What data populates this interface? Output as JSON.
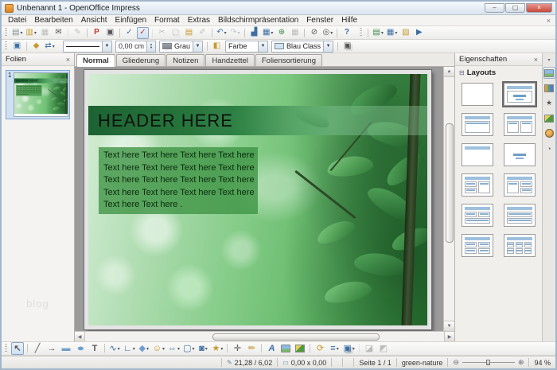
{
  "window": {
    "title": "Unbenannt 1 - OpenOffice Impress",
    "minimize": "–",
    "maximize": "▢",
    "close": "×",
    "doc_close": "×"
  },
  "menu": [
    "Datei",
    "Bearbeiten",
    "Ansicht",
    "Einfügen",
    "Format",
    "Extras",
    "Bildschirmpräsentation",
    "Fenster",
    "Hilfe"
  ],
  "toolbar_standard": [
    {
      "name": "new-icon",
      "g": "▤",
      "cls": "c-doc",
      "d": 1
    },
    {
      "name": "open-icon",
      "g": "▥",
      "cls": "c-gold",
      "d": 1
    },
    {
      "name": "save-icon",
      "g": "▦",
      "cls": "grayed"
    },
    {
      "name": "email-icon",
      "g": "✉"
    },
    {
      "name": "edit-file-icon",
      "g": "✎",
      "cls": "sep grayed"
    },
    {
      "name": "export-pdf-icon",
      "g": "P",
      "cls": "sep c-red bold"
    },
    {
      "name": "print-icon",
      "g": "▣"
    },
    {
      "name": "spellcheck-icon",
      "g": "✓",
      "cls": "sep c-blue"
    },
    {
      "name": "autospellcheck-icon",
      "g": "✓",
      "cls": "boxed c-red"
    },
    {
      "name": "cut-icon",
      "g": "✂",
      "cls": "sep grayed"
    },
    {
      "name": "copy-icon",
      "g": "▢",
      "cls": "grayed dbl"
    },
    {
      "name": "paste-icon",
      "g": "▤",
      "cls": "c-gold"
    },
    {
      "name": "format-paintbrush-icon",
      "g": "✐",
      "cls": "grayed"
    },
    {
      "name": "undo-icon",
      "g": "↶",
      "cls": "sep c-blue",
      "d": 1
    },
    {
      "name": "redo-icon",
      "g": "↷",
      "cls": "c-blue grayed",
      "d": 1
    },
    {
      "name": "chart-icon",
      "g": "▟",
      "cls": "sep c-blue"
    },
    {
      "name": "table-icon",
      "g": "▦",
      "cls": "c-blue",
      "d": 1
    },
    {
      "name": "hyperlink-icon",
      "g": "⊕",
      "cls": "c-green"
    },
    {
      "name": "grid-icon",
      "g": "▦",
      "cls": "grayed"
    },
    {
      "name": "zoom-icon",
      "g": "⊘",
      "cls": "sep"
    },
    {
      "name": "find-icon",
      "g": "◎",
      "d": 1
    },
    {
      "name": "help-icon",
      "g": "?",
      "cls": "sep c-blue bold"
    }
  ],
  "toolbar_presentation": [
    {
      "name": "slide-icon",
      "g": "▤",
      "cls": "sep c-green",
      "d": 1
    },
    {
      "name": "slide-layout-icon",
      "g": "▦",
      "cls": "c-blue",
      "d": 1
    },
    {
      "name": "slide-design-icon",
      "g": "▨",
      "cls": "c-gold"
    },
    {
      "name": "slideshow-icon",
      "g": "▶",
      "cls": "c-blue"
    }
  ],
  "line_fill": {
    "display_icon": {
      "name": "display-icon",
      "g": "▣"
    },
    "line_props_icon": {
      "name": "line-icon",
      "g": "◆"
    },
    "arrow_style_icon": {
      "name": "arrow-style-icon",
      "g": "⇄"
    },
    "line_width": "0,00 cm",
    "line_color": "Grau",
    "area_icon": {
      "name": "area-style-icon",
      "g": "◧"
    },
    "fill_type": "Farbe",
    "fill_color": "Blau Class",
    "shadow_icon": {
      "name": "shadow-icon",
      "g": "▣"
    }
  },
  "tabs": [
    {
      "label": "Normal",
      "active": true
    },
    {
      "label": "Gliederung"
    },
    {
      "label": "Notizen"
    },
    {
      "label": "Handzettel"
    },
    {
      "label": "Foliensortierung"
    }
  ],
  "slides_panel": {
    "title": "Folien",
    "close": "×",
    "slide_number": "1",
    "watermark": "blog"
  },
  "slide": {
    "header": "HEADER HERE",
    "body_lines": [
      "Text here Text here Text here Text here",
      "Text here Text here Text here Text here",
      "Text here Text here Text here Text here",
      "Text here Text here Text here Text here",
      "Text here Text here ."
    ]
  },
  "sidebar": {
    "title": "Eigenschaften",
    "close": "×",
    "collapse_icon": "⊟",
    "section": "Layouts",
    "layouts": [
      {
        "name": "layout-blank",
        "type": "blank"
      },
      {
        "name": "layout-title-slide",
        "type": "title-slide",
        "selected": true
      },
      {
        "name": "layout-title-content",
        "type": "title-content"
      },
      {
        "name": "layout-title-2content",
        "type": "title-2content"
      },
      {
        "name": "layout-title-only",
        "type": "title-only"
      },
      {
        "name": "layout-centered-text",
        "type": "centered-text"
      },
      {
        "name": "layout-title-2content-content",
        "type": "t2cc"
      },
      {
        "name": "layout-title-content-2content",
        "type": "tc2c"
      },
      {
        "name": "layout-title-2content-over-content",
        "type": "t2coc"
      },
      {
        "name": "layout-title-content-over-content",
        "type": "tcoc"
      },
      {
        "name": "layout-title-4content",
        "type": "t4c"
      },
      {
        "name": "layout-title-6content",
        "type": "t6c"
      }
    ],
    "tabs": [
      {
        "name": "sidebar-settings-icon",
        "g": "▾",
        "cls": "small"
      },
      {
        "name": "properties-tab-icon",
        "cls": "active"
      },
      {
        "name": "master-pages-tab-icon",
        "cls": ""
      },
      {
        "name": "animation-tab-icon",
        "g": "★",
        "cls": "c-gold"
      },
      {
        "name": "transition-tab-icon",
        "cls": ""
      },
      {
        "name": "gallery-tab-icon",
        "cls": ""
      },
      {
        "name": "navigator-tab-icon",
        "g": "◔",
        "cls": "c-blue"
      }
    ]
  },
  "drawing_toolbar": [
    {
      "name": "select-icon",
      "g": "↖",
      "cls": "boxed bold"
    },
    {
      "name": "line-icon",
      "g": "╱",
      "cls": "sep"
    },
    {
      "name": "arrow-icon",
      "g": "→"
    },
    {
      "name": "rectangle-icon",
      "g": "▬",
      "cls": "c-blue2"
    },
    {
      "name": "ellipse-icon",
      "g": "●",
      "cls": "c-blue2 squish"
    },
    {
      "name": "text-icon",
      "g": "T",
      "cls": "bold"
    },
    {
      "name": "curve-icon",
      "g": "∿",
      "cls": "sep c-blue",
      "d": 1
    },
    {
      "name": "connector-icon",
      "g": "∟",
      "cls": "c-blue",
      "d": 1
    },
    {
      "name": "basic-shapes-icon",
      "g": "◆",
      "cls": "c-blue2",
      "d": 1
    },
    {
      "name": "symbol-shapes-icon",
      "g": "☺",
      "cls": "c-gold",
      "d": 1
    },
    {
      "name": "block-arrows-icon",
      "g": "⇔",
      "cls": "c-blue",
      "d": 1
    },
    {
      "name": "flowchart-icon",
      "g": "▢",
      "cls": "c-blue",
      "d": 1
    },
    {
      "name": "callouts-icon",
      "g": "◙",
      "cls": "c-blue",
      "d": 1
    },
    {
      "name": "stars-icon",
      "g": "★",
      "cls": "c-gold",
      "d": 1
    },
    {
      "name": "edit-points-icon",
      "g": "✛",
      "cls": "sep"
    },
    {
      "name": "glue-points-icon",
      "g": "✏",
      "cls": "c-gold"
    },
    {
      "name": "fontwork-icon",
      "g": "A",
      "cls": "sep c-blue bold ital"
    },
    {
      "name": "image-icon",
      "cls": "haspic"
    },
    {
      "name": "gallery-icon",
      "cls": "haspic2"
    },
    {
      "name": "rotate-icon",
      "g": "⟳",
      "cls": "sep c-gold"
    },
    {
      "name": "align-icon",
      "g": "≡",
      "cls": "c-blue",
      "d": 1
    },
    {
      "name": "arrange-icon",
      "g": "▣",
      "cls": "c-blue dbl",
      "d": 1
    },
    {
      "name": "extrusion-icon",
      "g": "◪",
      "cls": "sep grayed"
    },
    {
      "name": "fontwork-gallery-icon",
      "g": "◩",
      "cls": "grayed"
    }
  ],
  "status_bar": {
    "position_icon": "✎",
    "position": "21,28 / 6,02",
    "size_icon": "▭",
    "size": "0,00 x 0,00",
    "page": "Seite 1 / 1",
    "template": "green-nature",
    "zoom_out": "⊖",
    "zoom_in": "⊕",
    "zoom": "94 %"
  }
}
